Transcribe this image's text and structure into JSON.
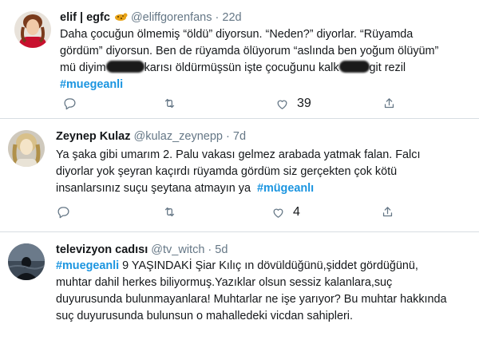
{
  "tweets": [
    {
      "name": "elif | egfc",
      "handle": "@eliffgorenfans",
      "dot": "·",
      "time": "22d",
      "badge_icon": "leopard-emoji-icon",
      "lines": [
        "Daha çocuğun ölmemiş “öldü” diyorsun. “Neden?” diyorlar. “Rüyamda",
        "gördüm” diyorsun. Ben de rüyamda ölüyorum “aslında ben yoğum ölüyüm”"
      ],
      "line3_a": "mü diyim",
      "line3_b": "karısı öldürmüşsün işte çocuğunu kalk",
      "line3_c": "git rezil",
      "hashtag": "#muegeanli",
      "reply_count": "",
      "retweet_count": "",
      "like_count": "39",
      "avatar_colors": [
        "#c8102e",
        "#f0c9a8",
        "#7a3b1c"
      ]
    },
    {
      "name": "Zeynep Kulaz",
      "handle": "@kulaz_zeynepp",
      "dot": "·",
      "time": "7d",
      "lines": [
        "Ya şaka gibi umarım 2. Palu vakası gelmez arabada yatmak falan. Falcı",
        "diyorlar yok şeyran kaçırdı rüyamda gördüm siz gerçekten çok kötü"
      ],
      "line3": "insanlarsınız suçu şeytana atmayın ya",
      "hashtag": "#mügeanlı",
      "reply_count": "",
      "retweet_count": "",
      "like_count": "4",
      "avatar_colors": [
        "#d8c08a",
        "#f4e4c8",
        "#b0904a"
      ]
    },
    {
      "name": "televizyon cadısı",
      "handle": "@tv_witch",
      "dot": "·",
      "time": "5d",
      "hashtag": "#muegeanli",
      "line1_rest": " 9 YAŞINDAKİ Şiar Kılıç ın dövüldüğünü,şiddet gördüğünü,",
      "lines": [
        "muhtar dahil herkes biliyormuş.Yazıklar olsun sessiz kalanlara,suç",
        "duyurusunda bulunmayanlara! Muhtarlar ne işe yarıyor? Bu muhtar hakkında",
        "suç duyurusunda bulunsun  o mahalledeki  vicdan sahipleri."
      ],
      "avatar_colors": [
        "#2b3440",
        "#5d6a78",
        "#11151a"
      ]
    }
  ]
}
